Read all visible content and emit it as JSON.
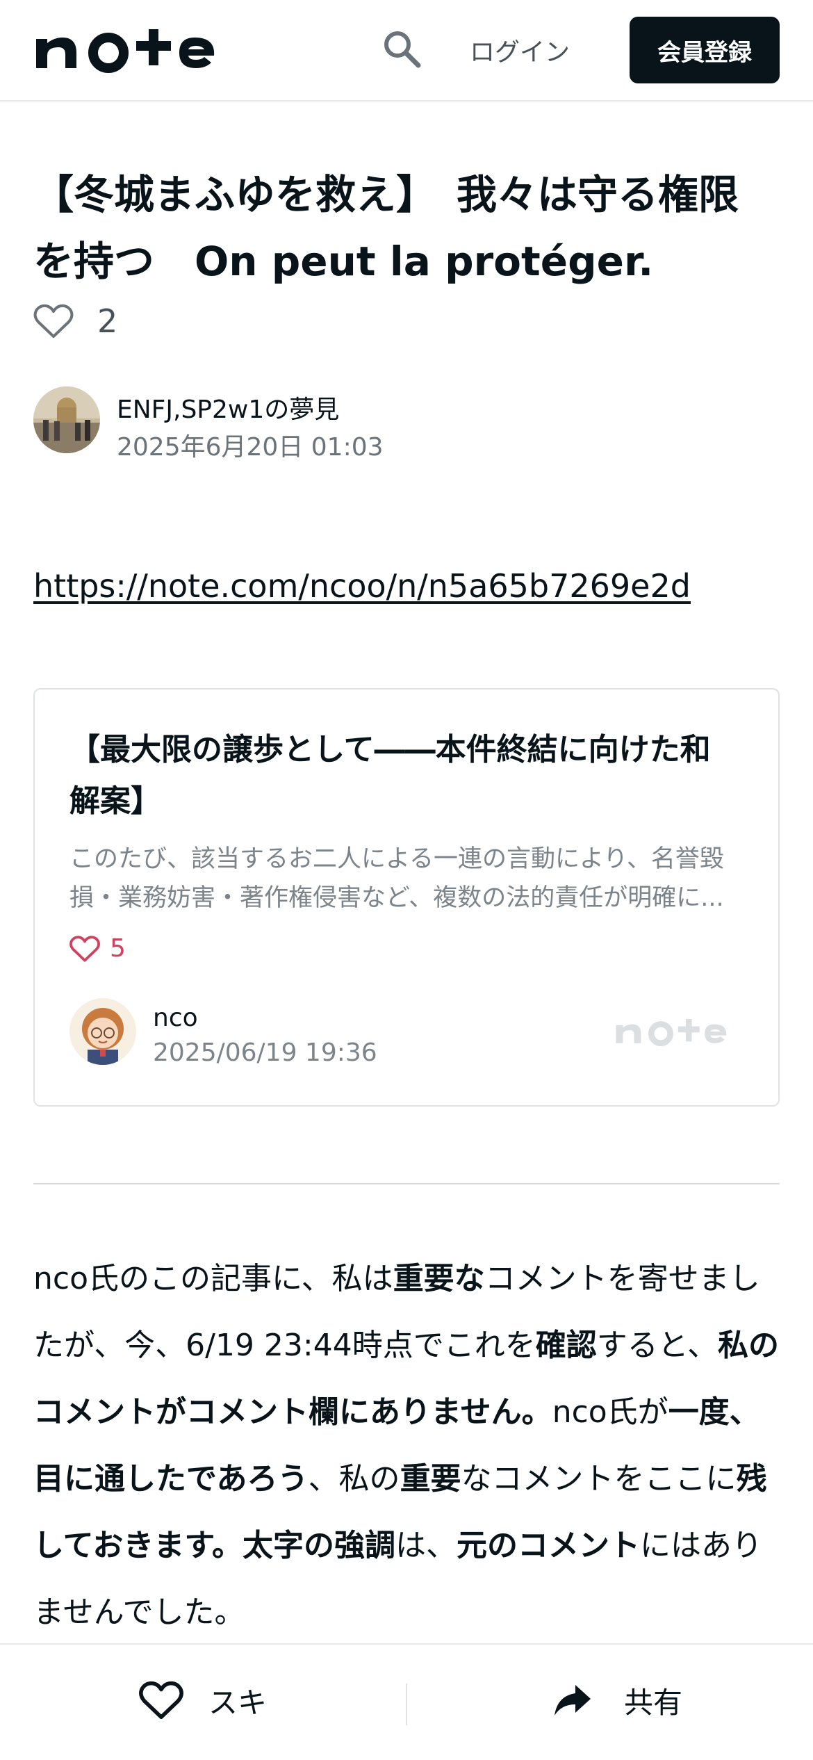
{
  "header": {
    "logo_text": "note",
    "login_label": "ログイン",
    "signup_label": "会員登録"
  },
  "article": {
    "title_line1": "【冬城まふゆを救え】　我々は守る権限",
    "title_line2": "を持つ　On peut la protéger.",
    "like_count": "2",
    "author_name": "ENFJ,SP2w1の夢見",
    "date": "2025年6月20日 01:03",
    "link": "https://note.com/ncoo/n/n5a65b7269e2d"
  },
  "embed": {
    "title_line1": "【最大限の譲歩として――本件終結に向けた和",
    "title_line2": "解案】",
    "excerpt_line1": "このたび、該当するお二人による一連の言動により、名誉毀",
    "excerpt_line2": "損・業務妨害・著作権侵害など、複数の法的責任が明確に...",
    "like_count": "5",
    "author": "nco",
    "date": "2025/06/19 19:36",
    "logo_text": "note"
  },
  "body": {
    "p1_a": "nco氏のこの記事に、私は",
    "p1_b": "重要な",
    "p1_c": "コメントを寄せましたが、今、6/19 23:44時点でこれを",
    "p1_d": "確認",
    "p1_e": "すると、",
    "p1_f": "私のコメントがコメント欄にありません。",
    "p1_g": "nco氏が",
    "p1_h": "一度、目に通したであろう",
    "p1_i": "、私の",
    "p1_j": "重要",
    "p1_k": "なコメントをここに",
    "p1_l": "残しておきます。太字の強調",
    "p1_m": "は、",
    "p1_n": "元のコメント",
    "p1_o": "にはありませんでした。"
  },
  "bottom_bar": {
    "like_label": "スキ",
    "share_label": "共有"
  },
  "colors": {
    "text": "#08131a",
    "muted": "#6b737a",
    "like_pink": "#d3405c",
    "button_dark": "#08131a"
  }
}
